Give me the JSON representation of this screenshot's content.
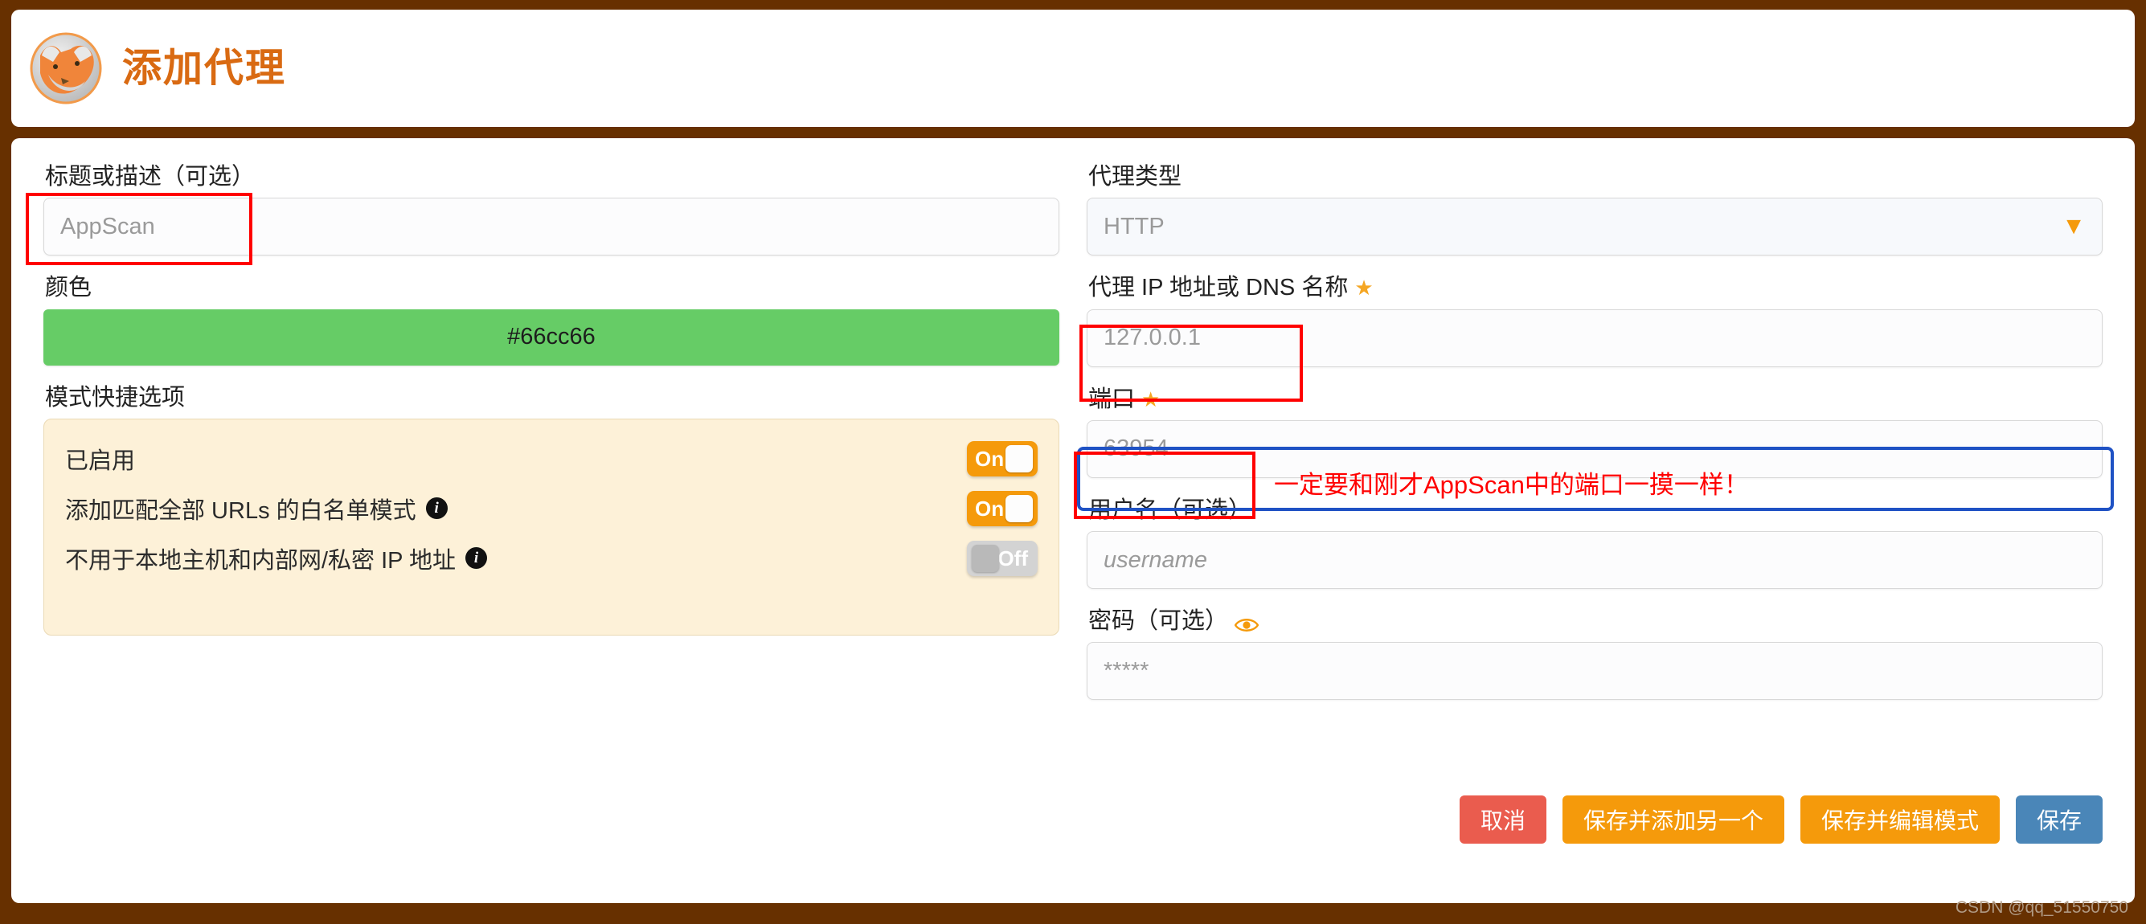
{
  "header": {
    "title": "添加代理",
    "logo_icon": "foxyproxy-fox-icon"
  },
  "left": {
    "title_label": "标题或描述（可选）",
    "title_placeholder": "AppScan",
    "color_label": "颜色",
    "color_value": "#66cc66",
    "mode_label": "模式快捷选项",
    "mode_rows": [
      {
        "label": "已启用",
        "state": "On",
        "has_info": false
      },
      {
        "label": "添加匹配全部 URLs 的白名单模式",
        "state": "On",
        "has_info": true
      },
      {
        "label": "不用于本地主机和内部网/私密 IP 地址",
        "state": "Off",
        "has_info": true
      }
    ]
  },
  "right": {
    "proxy_type_label": "代理类型",
    "proxy_type_value": "HTTP",
    "ip_label": "代理 IP 地址或 DNS 名称",
    "ip_placeholder": "127.0.0.1",
    "port_label": "端口",
    "port_placeholder": "63954",
    "username_label": "用户名（可选）",
    "username_placeholder": "username",
    "password_label": "密码（可选）",
    "password_placeholder": "*****"
  },
  "buttons": {
    "cancel": "取消",
    "save_add_another": "保存并添加另一个",
    "save_edit_patterns": "保存并编辑模式",
    "save": "保存"
  },
  "annotations": {
    "port_note": "一定要和刚才AppScan中的端口一摸一样！"
  },
  "watermark": "CSDN @qq_51550750"
}
